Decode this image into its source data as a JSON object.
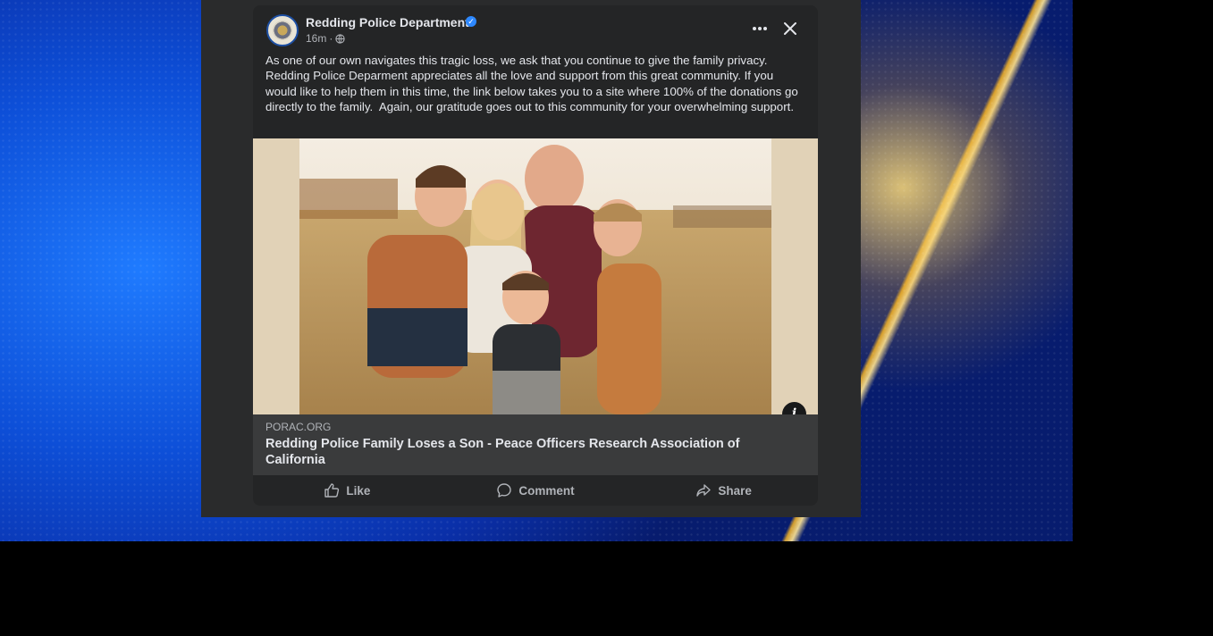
{
  "post": {
    "page_name": "Redding Police Department",
    "verified_icon": "verified-badge-icon",
    "time": "16m",
    "audience_icon": "globe-icon",
    "text": "As one of our own navigates this tragic loss, we ask that you continue to give the family privacy.\nRedding Police Deparment appreciates all the love and support from this great community. If you would like to help them in this time, the link below takes you to a site where 100% of the donations go directly to the family.  Again, our gratitude goes out to this community for your overwhelming support.",
    "link": {
      "domain": "PORAC.ORG",
      "title": "Redding Police Family Loses a Son - Peace Officers Research Association of California"
    },
    "actions": [
      {
        "label": "Like",
        "icon": "thumbs-up-icon"
      },
      {
        "label": "Comment",
        "icon": "comment-bubble-icon"
      },
      {
        "label": "Share",
        "icon": "share-arrow-icon"
      }
    ]
  },
  "colors": {
    "card_bg": "#242526",
    "link_bg": "#3a3b3c",
    "text_primary": "#e4e6eb",
    "text_secondary": "#b0b3b8",
    "verified_blue": "#2d88ff"
  }
}
